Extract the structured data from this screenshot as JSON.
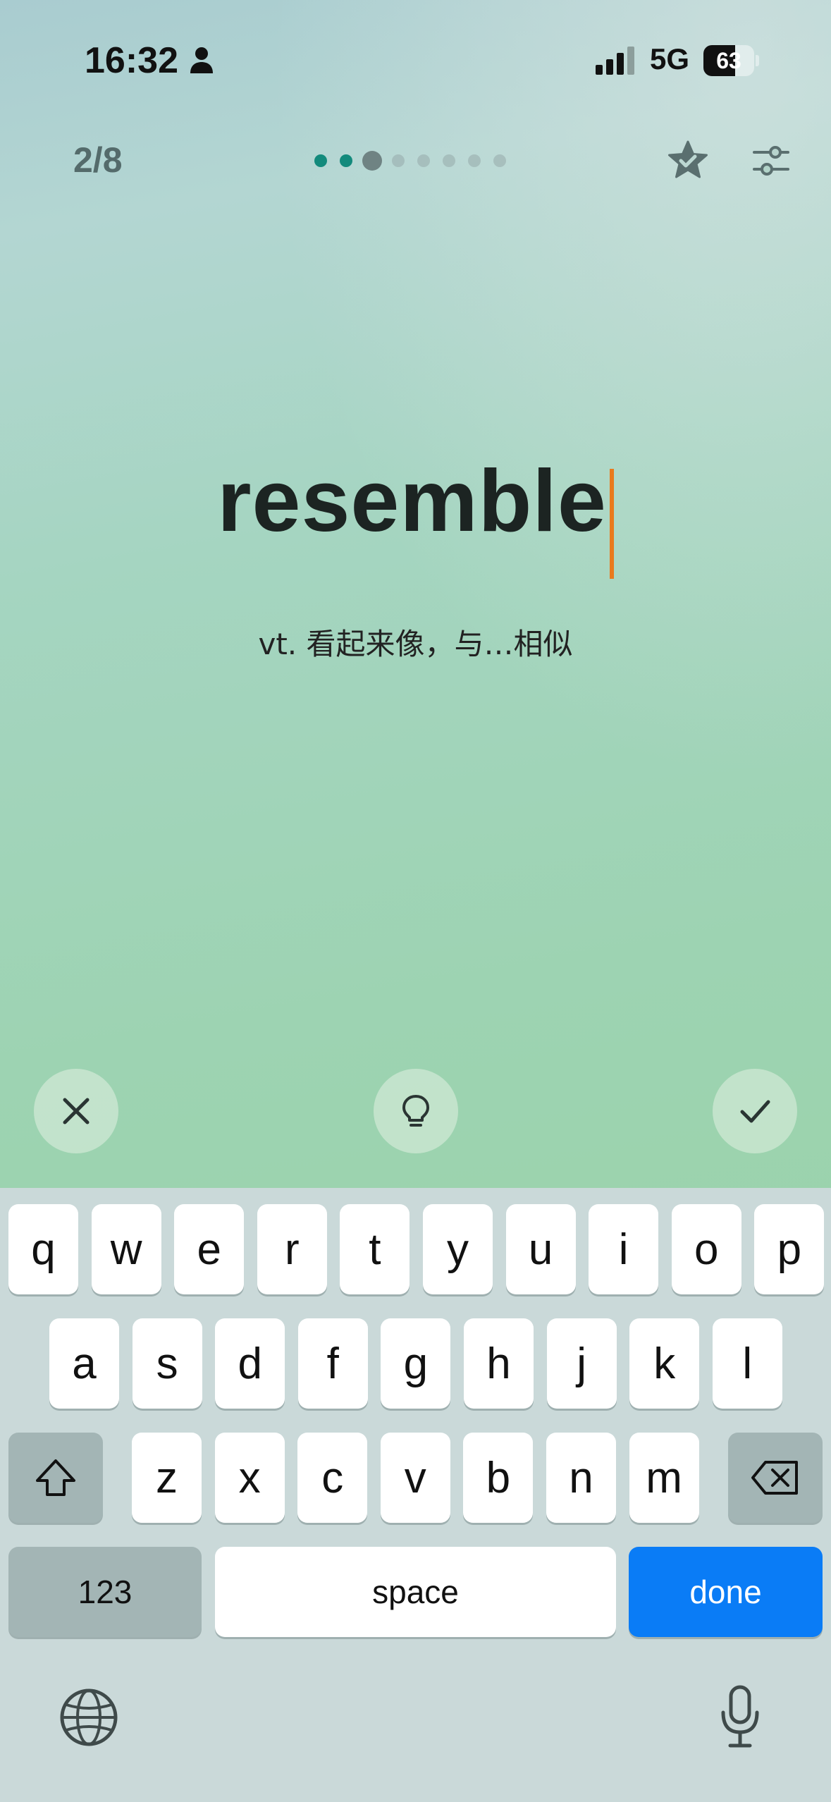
{
  "status_bar": {
    "time": "16:32",
    "network": "5G",
    "battery_percent": 63,
    "battery_label": "63",
    "icons": [
      "person-icon",
      "cellular-signal-icon",
      "battery-icon"
    ]
  },
  "header": {
    "progress_label": "2/8",
    "dots": {
      "total": 8,
      "completed": 2,
      "current_index": 2
    },
    "icons": [
      "star-check-icon",
      "sliders-icon"
    ]
  },
  "card": {
    "word": "resemble",
    "definition": "vt. 看起来像，与…相似"
  },
  "actions": {
    "icons": [
      "close-icon",
      "lightbulb-icon",
      "checkmark-icon"
    ]
  },
  "keyboard": {
    "row1": [
      "q",
      "w",
      "e",
      "r",
      "t",
      "y",
      "u",
      "i",
      "o",
      "p"
    ],
    "row2": [
      "a",
      "s",
      "d",
      "f",
      "g",
      "h",
      "j",
      "k",
      "l"
    ],
    "row3": [
      "z",
      "x",
      "c",
      "v",
      "b",
      "n",
      "m"
    ],
    "numbers_label": "123",
    "space_label": "space",
    "done_label": "done",
    "icons": [
      "shift-icon",
      "backspace-icon",
      "globe-icon",
      "microphone-icon"
    ]
  },
  "colors": {
    "accent_teal": "#138a7c",
    "caret_orange": "#e97a1d",
    "done_blue": "#0a7cf6"
  }
}
